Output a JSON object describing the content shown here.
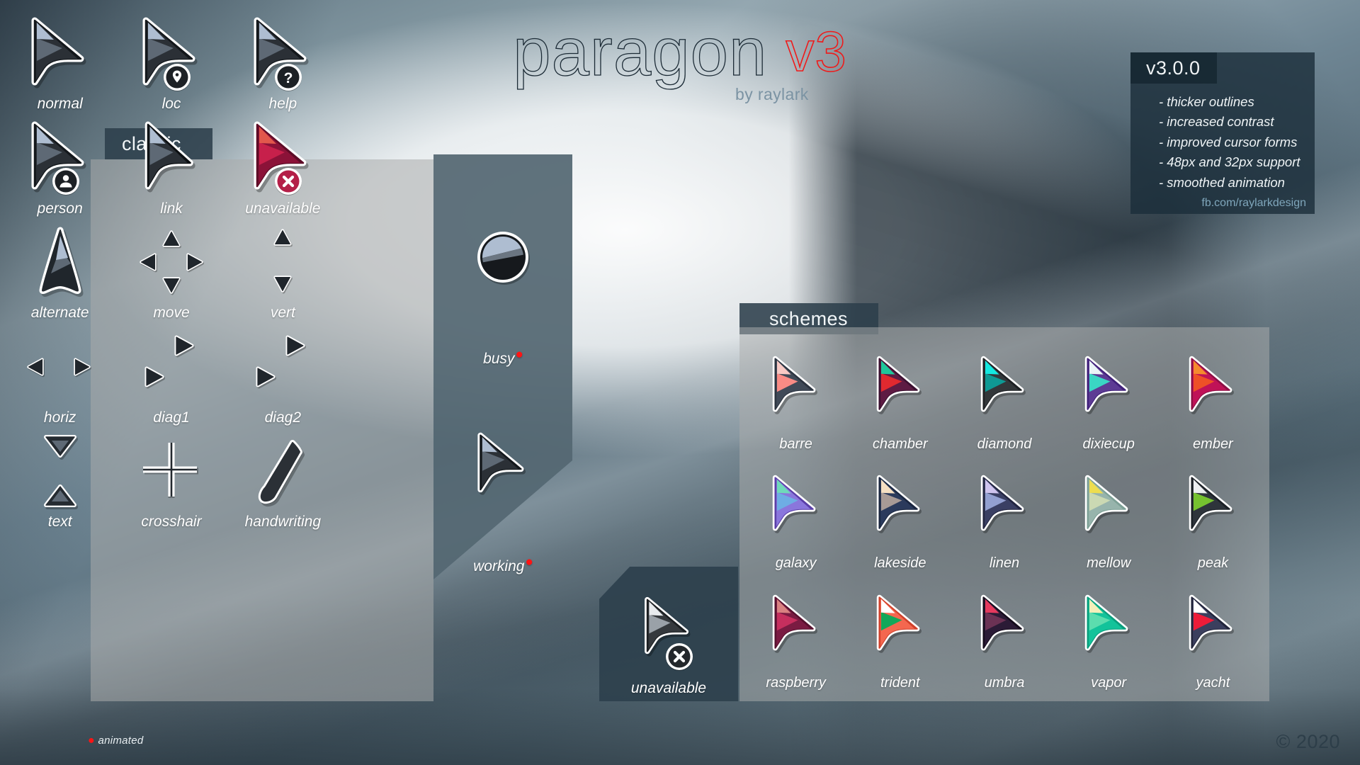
{
  "header": {
    "wordmark": "paragon",
    "version_mark": "v3",
    "byline": "by raylark"
  },
  "version_panel": {
    "title": "v3.0.0",
    "changes": [
      "- thicker outlines",
      "- increased contrast",
      "- improved cursor forms",
      "- 48px and 32px support",
      "- smoothed animation"
    ],
    "link": "fb.com/raylarkdesign"
  },
  "classic": {
    "tab_label": "classic",
    "items": [
      {
        "label": "normal",
        "icon": "cursor-arrow-icon",
        "animated": false
      },
      {
        "label": "loc",
        "icon": "cursor-location-pin-icon",
        "animated": false
      },
      {
        "label": "help",
        "icon": "cursor-question-mark-icon",
        "animated": false
      },
      {
        "label": "person",
        "icon": "cursor-person-icon",
        "animated": false
      },
      {
        "label": "link",
        "icon": "cursor-link-hand-icon",
        "animated": false
      },
      {
        "label": "unavailable",
        "icon": "cursor-unavailable-red-icon",
        "animated": false
      },
      {
        "label": "alternate",
        "icon": "cursor-alternate-up-icon",
        "animated": false
      },
      {
        "label": "move",
        "icon": "resize-move-four-way-icon",
        "animated": false
      },
      {
        "label": "vert",
        "icon": "resize-vertical-icon",
        "animated": false
      },
      {
        "label": "horiz",
        "icon": "resize-horizontal-icon",
        "animated": false
      },
      {
        "label": "diag1",
        "icon": "resize-diagonal-1-icon",
        "animated": false
      },
      {
        "label": "diag2",
        "icon": "resize-diagonal-2-icon",
        "animated": false
      },
      {
        "label": "text",
        "icon": "text-ibeam-icon",
        "animated": false
      },
      {
        "label": "crosshair",
        "icon": "crosshair-icon",
        "animated": false
      },
      {
        "label": "handwriting",
        "icon": "handwriting-pen-icon",
        "animated": false
      }
    ]
  },
  "mid": {
    "items": [
      {
        "label": "busy",
        "icon": "busy-spinner-disc-icon",
        "animated": true
      },
      {
        "label": "working",
        "icon": "working-arrow-icon",
        "animated": true
      }
    ]
  },
  "unavailable_panel": {
    "items": [
      {
        "label": "unavailable",
        "icon": "cursor-unavailable-grey-icon",
        "animated": false
      }
    ]
  },
  "schemes": {
    "tab_label": "schemes",
    "items": [
      {
        "label": "barre",
        "top": "#F8C9C4",
        "mid": "#F98B85",
        "body": "#404A58",
        "outline": "#2C3440"
      },
      {
        "label": "chamber",
        "top": "#1FC79A",
        "mid": "#E0292F",
        "body": "#5E1B43",
        "outline": "#3B1030"
      },
      {
        "label": "diamond",
        "top": "#14E8E0",
        "mid": "#0E9994",
        "body": "#33373A",
        "outline": "#1E2124"
      },
      {
        "label": "dixiecup",
        "top": "#EAF4F7",
        "mid": "#3AD6C4",
        "body": "#5D3B94",
        "outline": "#40207A"
      },
      {
        "label": "ember",
        "top": "#F58A2E",
        "mid": "#EE5026",
        "body": "#C01257",
        "outline": "#8E0F45"
      },
      {
        "label": "galaxy",
        "top": "#6FD9BA",
        "mid": "#6EADE4",
        "body": "#8A76DC",
        "outline": "#5B3FA8"
      },
      {
        "label": "lakeside",
        "top": "#F6DFC2",
        "mid": "#A89A96",
        "body": "#2B3A5C",
        "outline": "#1B2740"
      },
      {
        "label": "linen",
        "top": "#CFC4EE",
        "mid": "#93A0D1",
        "body": "#3A3F63",
        "outline": "#232641"
      },
      {
        "label": "mellow",
        "top": "#EDDD4F",
        "mid": "#CBD9B3",
        "body": "#97B4AC",
        "outline": "#7DA096"
      },
      {
        "label": "peak",
        "top": "#ECEEF0",
        "mid": "#76C230",
        "body": "#2E343B",
        "outline": "#1B2026"
      },
      {
        "label": "raspberry",
        "top": "#D98181",
        "mid": "#C62F5E",
        "body": "#7A1B42",
        "outline": "#57102E"
      },
      {
        "label": "trident",
        "top": "#FFFFFF",
        "mid": "#12A85A",
        "body": "#F4674F",
        "outline": "#D0412B"
      },
      {
        "label": "umbra",
        "top": "#E53A5E",
        "mid": "#6B3254",
        "body": "#2B1B36",
        "outline": "#150C1C"
      },
      {
        "label": "vapor",
        "top": "#F4EFBA",
        "mid": "#5CDDAE",
        "body": "#13C39A",
        "outline": "#0A9E7D"
      },
      {
        "label": "yacht",
        "top": "#FFFFFF",
        "mid": "#ED1C39",
        "body": "#3B3F5E",
        "outline": "#22253B"
      }
    ]
  },
  "footer": {
    "legend_dot": "●",
    "legend_label": "animated",
    "copyright": "© 2020"
  },
  "colors": {
    "accent_red": "#FF1414",
    "logo_red": "#EF1A1A",
    "tab_bg": "#2C3F4B",
    "panel_bg": "#AAACAC",
    "byline": "#7B93A3"
  }
}
